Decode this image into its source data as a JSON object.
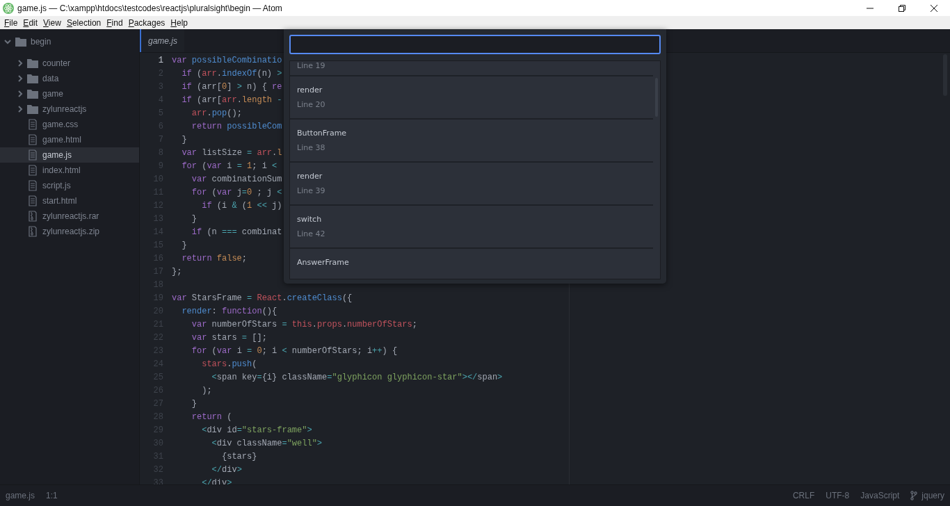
{
  "window": {
    "title": "game.js — C:\\xampp\\htdocs\\testcodes\\reactjs\\pluralsight\\begin — Atom"
  },
  "menu": [
    "File",
    "Edit",
    "View",
    "Selection",
    "Find",
    "Packages",
    "Help"
  ],
  "tree": {
    "name": "begin",
    "expanded": true,
    "children": [
      {
        "name": "counter",
        "kind": "folder",
        "expanded": false,
        "selected": false
      },
      {
        "name": "data",
        "kind": "folder",
        "expanded": false,
        "selected": false
      },
      {
        "name": "game",
        "kind": "folder",
        "expanded": false,
        "selected": false
      },
      {
        "name": "zylunreactjs",
        "kind": "folder",
        "expanded": false,
        "selected": false
      },
      {
        "name": "game.css",
        "kind": "file",
        "selected": false
      },
      {
        "name": "game.html",
        "kind": "file",
        "selected": false
      },
      {
        "name": "game.js",
        "kind": "file",
        "selected": true
      },
      {
        "name": "index.html",
        "kind": "file",
        "selected": false
      },
      {
        "name": "script.js",
        "kind": "file",
        "selected": false
      },
      {
        "name": "start.html",
        "kind": "file",
        "selected": false
      },
      {
        "name": "zylunreactjs.rar",
        "kind": "archive",
        "selected": false
      },
      {
        "name": "zylunreactjs.zip",
        "kind": "archive",
        "selected": false
      }
    ]
  },
  "tabs": [
    {
      "label": "game.js",
      "selected": true
    }
  ],
  "editor": {
    "lines": [
      {
        "number": "1",
        "current": true,
        "tokens": [
          {
            "text": "var ",
            "kind": "k"
          },
          {
            "text": "possibleCombinatio",
            "kind": "f"
          }
        ]
      },
      {
        "number": "2",
        "current": false,
        "tokens": [
          {
            "text": "  if",
            "kind": "k"
          },
          {
            "text": " (",
            "kind": "p"
          },
          {
            "text": "arr",
            "kind": "v"
          },
          {
            "text": ".",
            "kind": "p"
          },
          {
            "text": "indexOf",
            "kind": "f"
          },
          {
            "text": "(n) ",
            "kind": "p"
          },
          {
            "text": ">",
            "kind": "o"
          }
        ]
      },
      {
        "number": "3",
        "current": false,
        "tokens": [
          {
            "text": "  if",
            "kind": "k"
          },
          {
            "text": " (arr[",
            "kind": "p"
          },
          {
            "text": "0",
            "kind": "n"
          },
          {
            "text": "] ",
            "kind": "p"
          },
          {
            "text": ">",
            "kind": "o"
          },
          {
            "text": " n) { ",
            "kind": "p"
          },
          {
            "text": "re",
            "kind": "k"
          }
        ]
      },
      {
        "number": "4",
        "current": false,
        "tokens": [
          {
            "text": "  if",
            "kind": "k"
          },
          {
            "text": " (arr[",
            "kind": "p"
          },
          {
            "text": "arr",
            "kind": "v"
          },
          {
            "text": ".",
            "kind": "p"
          },
          {
            "text": "length ",
            "kind": "n"
          },
          {
            "text": "-",
            "kind": "o"
          }
        ]
      },
      {
        "number": "5",
        "current": false,
        "tokens": [
          {
            "text": "    arr",
            "kind": "v"
          },
          {
            "text": ".",
            "kind": "p"
          },
          {
            "text": "pop",
            "kind": "f"
          },
          {
            "text": "();",
            "kind": "p"
          }
        ]
      },
      {
        "number": "6",
        "current": false,
        "tokens": [
          {
            "text": "    return ",
            "kind": "k"
          },
          {
            "text": "possibleCom",
            "kind": "f"
          }
        ]
      },
      {
        "number": "7",
        "current": false,
        "tokens": [
          {
            "text": "  }",
            "kind": "p"
          }
        ]
      },
      {
        "number": "8",
        "current": false,
        "tokens": [
          {
            "text": "  var",
            "kind": "k"
          },
          {
            "text": " listSize ",
            "kind": "p"
          },
          {
            "text": "= ",
            "kind": "o"
          },
          {
            "text": "arr",
            "kind": "v"
          },
          {
            "text": ".",
            "kind": "p"
          },
          {
            "text": "l",
            "kind": "n"
          }
        ]
      },
      {
        "number": "9",
        "current": false,
        "tokens": [
          {
            "text": "  for",
            "kind": "k"
          },
          {
            "text": " (",
            "kind": "p"
          },
          {
            "text": "var",
            "kind": "k"
          },
          {
            "text": " i ",
            "kind": "p"
          },
          {
            "text": "= ",
            "kind": "o"
          },
          {
            "text": "1",
            "kind": "n"
          },
          {
            "text": "; i ",
            "kind": "p"
          },
          {
            "text": "<",
            "kind": "o"
          }
        ]
      },
      {
        "number": "10",
        "current": false,
        "tokens": [
          {
            "text": "    var",
            "kind": "k"
          },
          {
            "text": " combinationSum",
            "kind": "p"
          }
        ]
      },
      {
        "number": "11",
        "current": false,
        "tokens": [
          {
            "text": "    for",
            "kind": "k"
          },
          {
            "text": " (",
            "kind": "p"
          },
          {
            "text": "var",
            "kind": "k"
          },
          {
            "text": " j",
            "kind": "p"
          },
          {
            "text": "=",
            "kind": "o"
          },
          {
            "text": "0",
            "kind": "n"
          },
          {
            "text": " ; j ",
            "kind": "p"
          },
          {
            "text": "<",
            "kind": "o"
          }
        ]
      },
      {
        "number": "12",
        "current": false,
        "tokens": [
          {
            "text": "      if",
            "kind": "k"
          },
          {
            "text": " (i ",
            "kind": "p"
          },
          {
            "text": "&",
            "kind": "o"
          },
          {
            "text": " (",
            "kind": "p"
          },
          {
            "text": "1 ",
            "kind": "n"
          },
          {
            "text": "<<",
            "kind": "o"
          },
          {
            "text": " j)",
            "kind": "p"
          }
        ]
      },
      {
        "number": "13",
        "current": false,
        "tokens": [
          {
            "text": "    }",
            "kind": "p"
          }
        ]
      },
      {
        "number": "14",
        "current": false,
        "tokens": [
          {
            "text": "    if",
            "kind": "k"
          },
          {
            "text": " (n ",
            "kind": "p"
          },
          {
            "text": "===",
            "kind": "o"
          },
          {
            "text": " combinat",
            "kind": "p"
          }
        ]
      },
      {
        "number": "15",
        "current": false,
        "tokens": [
          {
            "text": "  }",
            "kind": "p"
          }
        ]
      },
      {
        "number": "16",
        "current": false,
        "tokens": [
          {
            "text": "  return ",
            "kind": "k"
          },
          {
            "text": "false",
            "kind": "n"
          },
          {
            "text": ";",
            "kind": "p"
          }
        ]
      },
      {
        "number": "17",
        "current": false,
        "tokens": [
          {
            "text": "};",
            "kind": "p"
          }
        ]
      },
      {
        "number": "18",
        "current": false
      },
      {
        "number": "19",
        "current": false,
        "tokens": [
          {
            "text": "var",
            "kind": "k"
          },
          {
            "text": " StarsFrame ",
            "kind": "p"
          },
          {
            "text": "= ",
            "kind": "o"
          },
          {
            "text": "React",
            "kind": "v"
          },
          {
            "text": ".",
            "kind": "p"
          },
          {
            "text": "createClass",
            "kind": "f"
          },
          {
            "text": "({",
            "kind": "p"
          }
        ]
      },
      {
        "number": "20",
        "current": false,
        "tokens": [
          {
            "text": "  render",
            "kind": "f"
          },
          {
            "text": ": ",
            "kind": "p"
          },
          {
            "text": "function",
            "kind": "k"
          },
          {
            "text": "(){",
            "kind": "p"
          }
        ]
      },
      {
        "number": "21",
        "current": false,
        "tokens": [
          {
            "text": "    var",
            "kind": "k"
          },
          {
            "text": " numberOfStars ",
            "kind": "p"
          },
          {
            "text": "= ",
            "kind": "o"
          },
          {
            "text": "this",
            "kind": "v"
          },
          {
            "text": ".",
            "kind": "p"
          },
          {
            "text": "props",
            "kind": "v"
          },
          {
            "text": ".",
            "kind": "p"
          },
          {
            "text": "numberOfStars",
            "kind": "v"
          },
          {
            "text": ";",
            "kind": "p"
          }
        ]
      },
      {
        "number": "22",
        "current": false,
        "tokens": [
          {
            "text": "    var",
            "kind": "k"
          },
          {
            "text": " stars ",
            "kind": "p"
          },
          {
            "text": "=",
            "kind": "o"
          },
          {
            "text": " [];",
            "kind": "p"
          }
        ]
      },
      {
        "number": "23",
        "current": false,
        "tokens": [
          {
            "text": "    for",
            "kind": "k"
          },
          {
            "text": " (",
            "kind": "p"
          },
          {
            "text": "var",
            "kind": "k"
          },
          {
            "text": " i ",
            "kind": "p"
          },
          {
            "text": "= ",
            "kind": "o"
          },
          {
            "text": "0",
            "kind": "n"
          },
          {
            "text": "; i ",
            "kind": "p"
          },
          {
            "text": "<",
            "kind": "o"
          },
          {
            "text": " numberOfStars; i",
            "kind": "p"
          },
          {
            "text": "++",
            "kind": "o"
          },
          {
            "text": ") {",
            "kind": "p"
          }
        ]
      },
      {
        "number": "24",
        "current": false,
        "tokens": [
          {
            "text": "      stars",
            "kind": "v"
          },
          {
            "text": ".",
            "kind": "p"
          },
          {
            "text": "push",
            "kind": "f"
          },
          {
            "text": "(",
            "kind": "p"
          }
        ]
      },
      {
        "number": "25",
        "current": false,
        "tokens": [
          {
            "text": "        <",
            "kind": "t"
          },
          {
            "text": "span key",
            "kind": "p"
          },
          {
            "text": "=",
            "kind": "o"
          },
          {
            "text": "{i} className",
            "kind": "p"
          },
          {
            "text": "=",
            "kind": "o"
          },
          {
            "text": "\"glyphicon glyphicon-star\"",
            "kind": "s"
          },
          {
            "text": "></",
            "kind": "t"
          },
          {
            "text": "span",
            "kind": "p"
          },
          {
            "text": ">",
            "kind": "t"
          }
        ]
      },
      {
        "number": "26",
        "current": false,
        "tokens": [
          {
            "text": "      );",
            "kind": "p"
          }
        ]
      },
      {
        "number": "27",
        "current": false,
        "tokens": [
          {
            "text": "    }",
            "kind": "p"
          }
        ]
      },
      {
        "number": "28",
        "current": false,
        "tokens": [
          {
            "text": "    return",
            "kind": "k"
          },
          {
            "text": " (",
            "kind": "p"
          }
        ]
      },
      {
        "number": "29",
        "current": false,
        "tokens": [
          {
            "text": "      <",
            "kind": "t"
          },
          {
            "text": "div id",
            "kind": "p"
          },
          {
            "text": "=",
            "kind": "o"
          },
          {
            "text": "\"stars-frame\"",
            "kind": "s"
          },
          {
            "text": ">",
            "kind": "t"
          }
        ]
      },
      {
        "number": "30",
        "current": false,
        "tokens": [
          {
            "text": "        <",
            "kind": "t"
          },
          {
            "text": "div className",
            "kind": "p"
          },
          {
            "text": "=",
            "kind": "o"
          },
          {
            "text": "\"well\"",
            "kind": "s"
          },
          {
            "text": ">",
            "kind": "t"
          }
        ]
      },
      {
        "number": "31",
        "current": false,
        "tokens": [
          {
            "text": "          {stars}",
            "kind": "p"
          }
        ]
      },
      {
        "number": "32",
        "current": false,
        "tokens": [
          {
            "text": "        </",
            "kind": "t"
          },
          {
            "text": "div",
            "kind": "p"
          },
          {
            "text": ">",
            "kind": "t"
          }
        ]
      },
      {
        "number": "33",
        "current": false,
        "tokens": [
          {
            "text": "      </",
            "kind": "t"
          },
          {
            "text": "div",
            "kind": "p"
          },
          {
            "text": ">",
            "kind": "t"
          }
        ]
      }
    ]
  },
  "symbol_search": {
    "items": [
      {
        "line": "Line 19"
      },
      {
        "name": "render",
        "line": "Line 20"
      },
      {
        "name": "ButtonFrame",
        "line": "Line 38"
      },
      {
        "name": "render",
        "line": "Line 39"
      },
      {
        "name": "switch",
        "line": "Line 42"
      },
      {
        "name": "AnswerFrame"
      }
    ]
  },
  "status_bar": {
    "file": "game.js",
    "cursor": "1:1",
    "line_ending": "CRLF",
    "encoding": "UTF-8",
    "grammar": "JavaScript",
    "branch": "jquery"
  }
}
